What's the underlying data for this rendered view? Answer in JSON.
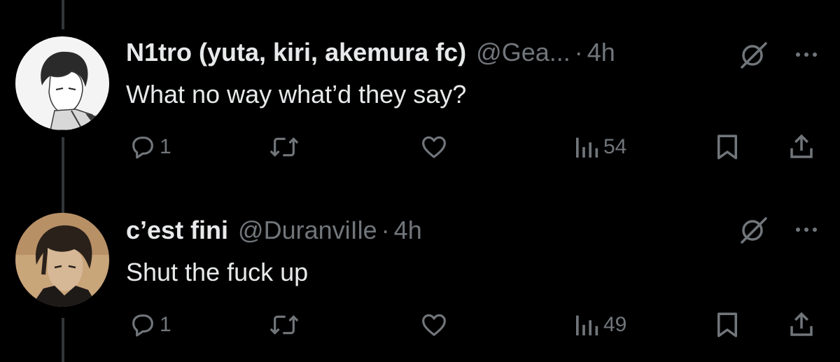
{
  "colors": {
    "background": "#000000",
    "primary_text": "#e7e9ea",
    "secondary_text": "#71767b",
    "thread_line": "#333639"
  },
  "tweets": [
    {
      "display_name": "N1tro (yuta, kiri, akemura fc)",
      "handle": "@Gea...",
      "separator": "·",
      "time": "4h",
      "text": "What no way what’d they say?",
      "avatar_icon": "anime-character-avatar-monochrome",
      "actions": {
        "replies": "1",
        "reposts": "",
        "likes": "",
        "views": "54"
      }
    },
    {
      "display_name": "c’est fini",
      "handle": "@DuranviIle",
      "separator": "·",
      "time": "4h",
      "text": "Shut the fuck up",
      "avatar_icon": "anime-character-avatar-color",
      "actions": {
        "replies": "1",
        "reposts": "",
        "likes": "",
        "views": "49"
      }
    }
  ],
  "icons": {
    "grok": "grok-icon",
    "more": "more-icon",
    "reply": "reply-icon",
    "repost": "repost-icon",
    "like": "heart-icon",
    "views": "views-icon",
    "bookmark": "bookmark-icon",
    "share": "share-icon"
  }
}
